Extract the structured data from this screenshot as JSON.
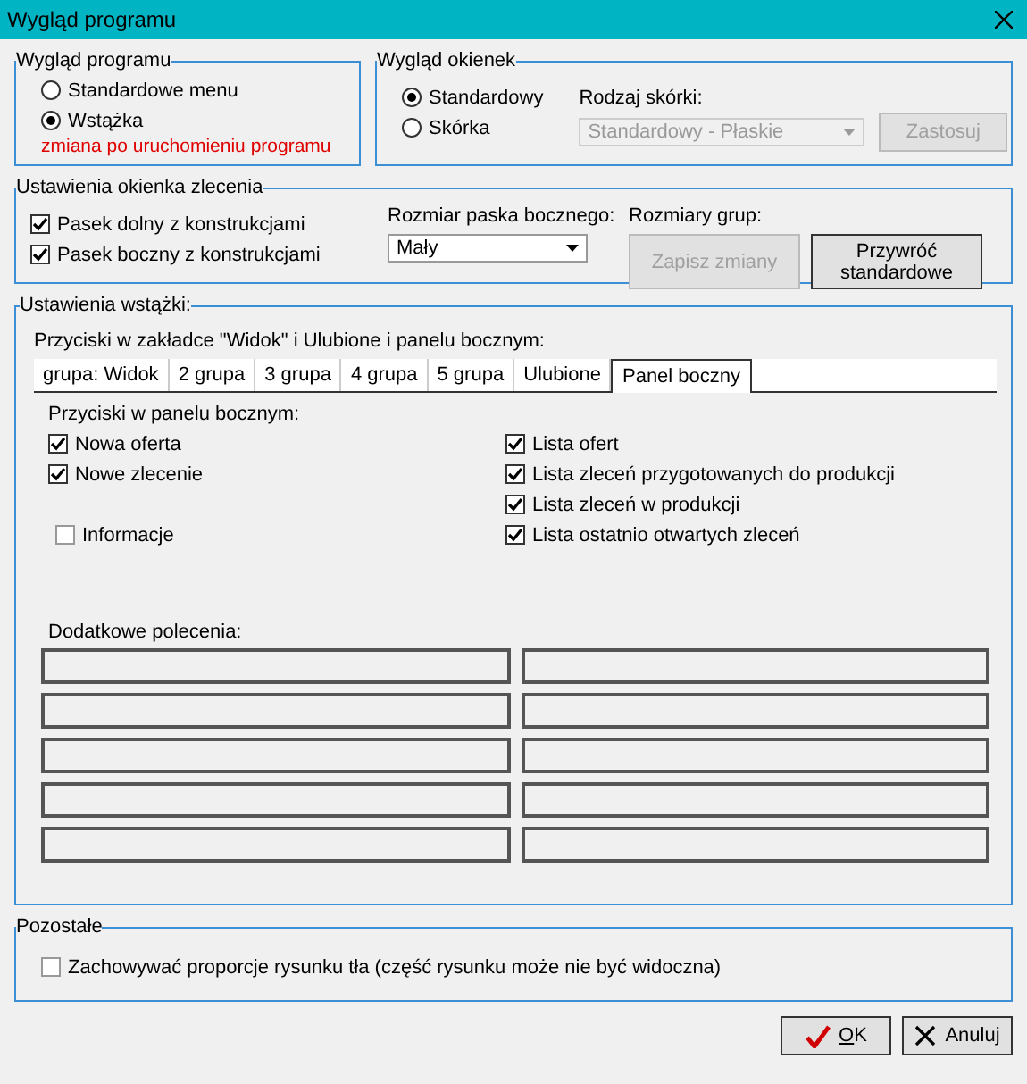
{
  "window": {
    "title": "Wygląd programu"
  },
  "program_look": {
    "legend": "Wygląd programu",
    "options": [
      {
        "label": "Standardowe menu",
        "selected": false
      },
      {
        "label": "Wstążka",
        "selected": true
      }
    ],
    "note": "zmiana po uruchomieniu programu"
  },
  "window_look": {
    "legend": "Wygląd okienek",
    "options": [
      {
        "label": "Standardowy",
        "selected": true
      },
      {
        "label": "Skórka",
        "selected": false
      }
    ],
    "skin_label": "Rodzaj skórki:",
    "skin_dropdown": {
      "value": "Standardowy - Płaskie",
      "disabled": true
    },
    "apply_button": {
      "label": "Zastosuj",
      "disabled": true
    }
  },
  "order_window": {
    "legend": "Ustawienia okienka zlecenia",
    "checkboxes": [
      {
        "label": "Pasek dolny z konstrukcjami",
        "checked": true
      },
      {
        "label": "Pasek boczny z konstrukcjami",
        "checked": true
      }
    ],
    "sidebar_size_label": "Rozmiar paska bocznego:",
    "sidebar_size_dropdown": {
      "value": "Mały",
      "disabled": false
    },
    "group_sizes_label": "Rozmiary grup:",
    "save_button": {
      "label": "Zapisz zmiany",
      "disabled": true
    },
    "restore_button": {
      "label": "Przywróć standardowe",
      "disabled": false
    }
  },
  "ribbon": {
    "legend": "Ustawienia wstążki:",
    "caption": "Przyciski w zakładce \"Widok\" i Ulubione i panelu bocznym:",
    "tabs": [
      {
        "label": "grupa: Widok",
        "selected": false
      },
      {
        "label": "2 grupa",
        "selected": false
      },
      {
        "label": "3 grupa",
        "selected": false
      },
      {
        "label": "4 grupa",
        "selected": false
      },
      {
        "label": "5 grupa",
        "selected": false
      },
      {
        "label": "Ulubione",
        "selected": false
      },
      {
        "label": "Panel boczny",
        "selected": true
      }
    ],
    "panel_caption": "Przyciski w panelu bocznym:",
    "left_items": [
      {
        "label": "Nowa oferta",
        "checked": true
      },
      {
        "label": "Nowe zlecenie",
        "checked": true
      },
      {
        "label": "Informacje",
        "checked": false
      }
    ],
    "right_items": [
      {
        "label": "Lista ofert",
        "checked": true
      },
      {
        "label": "Lista zleceń przygotowanych do produkcji",
        "checked": true
      },
      {
        "label": "Lista zleceń w produkcji",
        "checked": true
      },
      {
        "label": "Lista ostatnio otwartych zleceń",
        "checked": true
      }
    ],
    "extra_caption": "Dodatkowe polecenia:"
  },
  "other": {
    "legend": "Pozostałe",
    "checkboxes": [
      {
        "label": "Zachowywać proporcje rysunku tła (część rysunku może nie być widoczna)",
        "checked": false
      }
    ]
  },
  "buttons": [
    {
      "kind": "ok",
      "label": "OK"
    },
    {
      "kind": "cancel",
      "label": "Anuluj"
    }
  ]
}
